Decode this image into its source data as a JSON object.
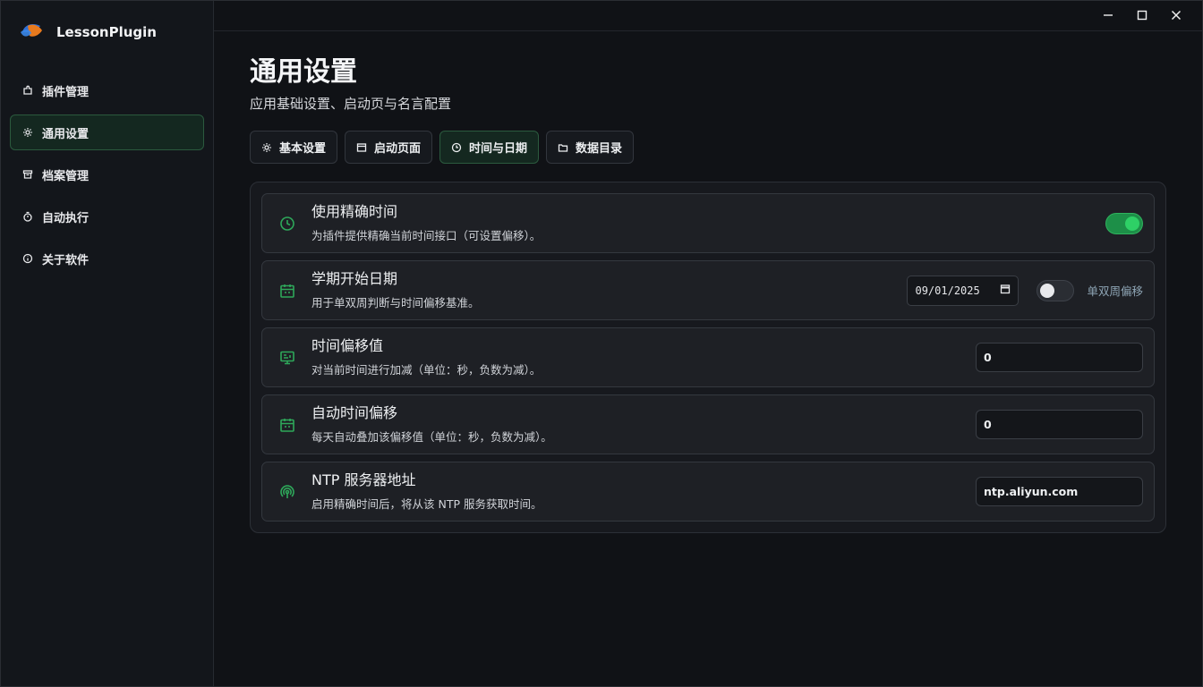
{
  "app": {
    "name": "LessonPlugin"
  },
  "sidebar": {
    "items": [
      {
        "label": "插件管理",
        "icon": "plugin-icon",
        "active": false
      },
      {
        "label": "通用设置",
        "icon": "gear-icon",
        "active": true
      },
      {
        "label": "档案管理",
        "icon": "archive-icon",
        "active": false
      },
      {
        "label": "自动执行",
        "icon": "timer-icon",
        "active": false
      },
      {
        "label": "关于软件",
        "icon": "info-icon",
        "active": false
      }
    ]
  },
  "window": {
    "minimize": "minimize-icon",
    "maximize": "maximize-icon",
    "close": "close-icon"
  },
  "page": {
    "title": "通用设置",
    "subtitle": "应用基础设置、启动页与名言配置"
  },
  "tabs": [
    {
      "label": "基本设置",
      "icon": "gear-icon",
      "active": false
    },
    {
      "label": "启动页面",
      "icon": "window-icon",
      "active": false
    },
    {
      "label": "时间与日期",
      "icon": "clock-icon",
      "active": true
    },
    {
      "label": "数据目录",
      "icon": "folder-icon",
      "active": false
    }
  ],
  "settings": {
    "precise_time": {
      "title": "使用精确时间",
      "desc": "为插件提供精确当前时间接口（可设置偏移）。",
      "enabled": true
    },
    "term_start": {
      "title": "学期开始日期",
      "desc": "用于单双周判断与时间偏移基准。",
      "date": "09/01/2025",
      "toggle_label": "单双周偏移",
      "toggle_enabled": false
    },
    "time_offset": {
      "title": "时间偏移值",
      "desc": "对当前时间进行加减（单位：秒，负数为减）。",
      "value": "0"
    },
    "auto_offset": {
      "title": "自动时间偏移",
      "desc": "每天自动叠加该偏移值（单位：秒，负数为减）。",
      "value": "0"
    },
    "ntp": {
      "title": "NTP 服务器地址",
      "desc": "启用精确时间后，将从该 NTP 服务获取时间。",
      "value": "ntp.aliyun.com"
    }
  },
  "colors": {
    "accent": "#2ed066",
    "accent_icon": "#2ea85a",
    "active_bg": "#142820",
    "active_border": "#2b5a3e"
  }
}
